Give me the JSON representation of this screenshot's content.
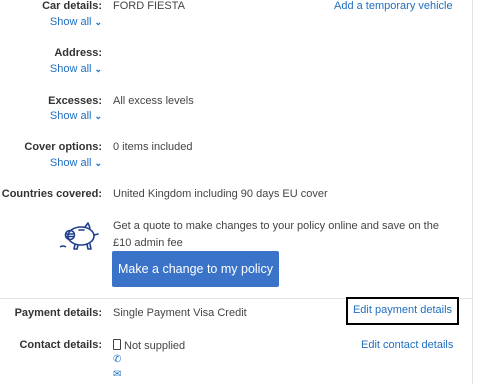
{
  "rows": {
    "car_details": {
      "label": "Car details:",
      "value": "FORD FIESTA",
      "show_all": "Show all",
      "action": "Add a temporary vehicle"
    },
    "address": {
      "label": "Address:",
      "show_all": "Show all"
    },
    "excesses": {
      "label": "Excesses:",
      "value": "All excess levels",
      "show_all": "Show all"
    },
    "cover_options": {
      "label": "Cover options:",
      "value": "0 items included",
      "show_all": "Show all"
    },
    "countries_covered": {
      "label": "Countries covered:",
      "value": "United Kingdom including 90 days EU cover"
    },
    "payment_details": {
      "label": "Payment details:",
      "value": "Single Payment Visa Credit",
      "action": "Edit payment details"
    },
    "contact_details": {
      "label": "Contact details:",
      "value": "Not supplied",
      "action": "Edit contact details"
    }
  },
  "quote": {
    "text": "Get a quote to make changes to your policy online and save on the £10 admin fee",
    "button": "Make a change to my policy",
    "icon": "piggy-bank-icon"
  },
  "contact_icons": [
    "mobile-icon",
    "phone-icon",
    "envelope-icon"
  ],
  "colors": {
    "link": "#1f6fc0",
    "button": "#3b73c8",
    "highlight_border": "#000000"
  }
}
